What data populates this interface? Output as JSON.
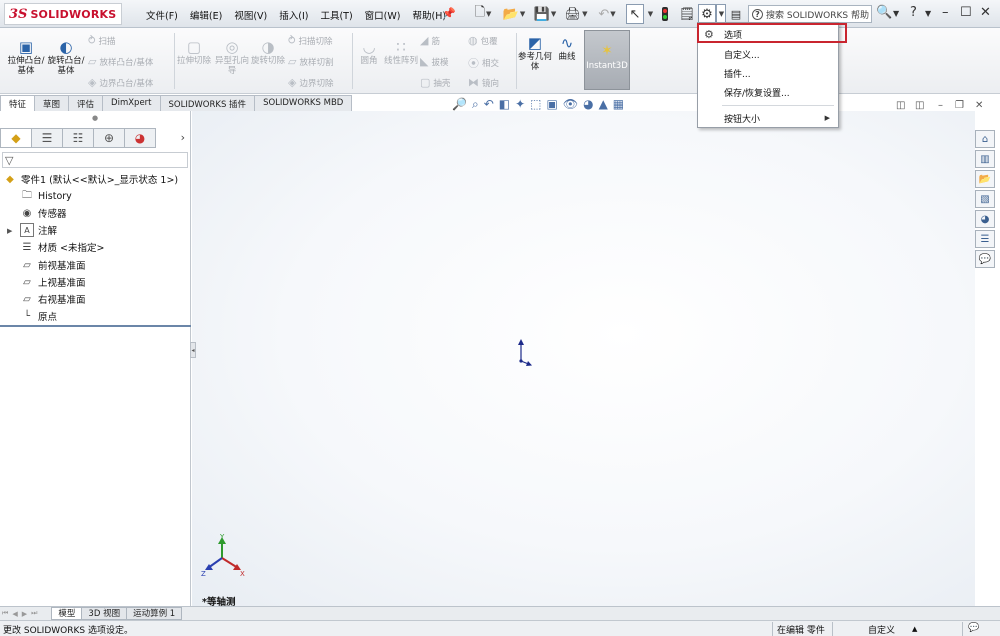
{
  "app": {
    "logo_ds": "3S",
    "logo_brand": "SOLIDWORKS"
  },
  "menu": [
    "文件(F)",
    "编辑(E)",
    "视图(V)",
    "插入(I)",
    "工具(T)",
    "窗口(W)",
    "帮助(H)"
  ],
  "search": {
    "placeholder": "搜索 SOLIDWORKS 帮助"
  },
  "commands": {
    "extrude_boss": "拉伸凸台/基体",
    "revolve_boss": "旋转凸台/基体",
    "sweep": "扫描",
    "loft_boss": "放样凸台/基体",
    "boundary_boss": "边界凸台/基体",
    "extrude_cut": "拉伸切除",
    "hole_wizard": "异型孔向导",
    "revolve_cut": "旋转切除",
    "swept_cut": "扫描切除",
    "lofted_cut": "放样切割",
    "boundary_cut": "边界切除",
    "fillet": "圆角",
    "linear_pattern": "线性阵列",
    "rib": "筋",
    "draft": "拔模",
    "shell": "抽壳",
    "wrap": "包覆",
    "intersect": "相交",
    "mirror": "镜向",
    "reference_geometry": "参考几何体",
    "curves": "曲线",
    "instant3d": "Instant3D"
  },
  "tabs": [
    "特征",
    "草图",
    "评估",
    "DimXpert",
    "SOLIDWORKS 插件",
    "SOLIDWORKS MBD"
  ],
  "tree": {
    "root": "零件1  (默认<<默认>_显示状态 1>)",
    "items": [
      "History",
      "传感器",
      "注解",
      "材质 <未指定>",
      "前视基准面",
      "上视基准面",
      "右视基准面",
      "原点"
    ]
  },
  "dropdown": {
    "items": [
      "选项",
      "自定义...",
      "插件...",
      "保存/恢复设置...",
      "按钮大小"
    ]
  },
  "viewport": {
    "view_label": "*等轴测",
    "triad_x": "X",
    "triad_y": "Y",
    "triad_z": "Z"
  },
  "bottom_tabs": [
    "模型",
    "3D 视图",
    "运动算例 1"
  ],
  "status": {
    "message": "更改 SOLIDWORKS 选项设定。",
    "editing": "在编辑 零件",
    "custom": "自定义"
  },
  "colors": {
    "brand_red": "#c8102e",
    "highlight_red": "#c9252f",
    "accent_blue": "#2b63a8"
  }
}
